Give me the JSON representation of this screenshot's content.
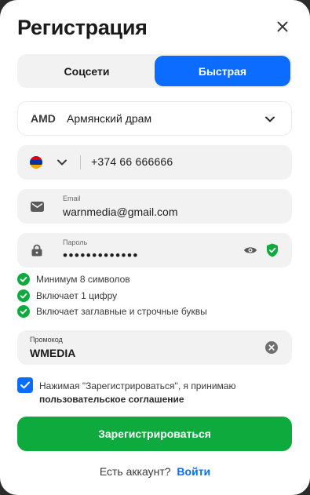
{
  "modal": {
    "title": "Регистрация"
  },
  "tabs": [
    {
      "label": "Соцсети",
      "active": false
    },
    {
      "label": "Быстрая",
      "active": true
    }
  ],
  "currency": {
    "code": "AMD",
    "name": "Армянский драм"
  },
  "phone": {
    "country_flag": "Armenia",
    "value": "+374 66 666666"
  },
  "email": {
    "label": "Email",
    "value": "warnmedia@gmail.com"
  },
  "password": {
    "label": "Пароль",
    "value": "•••••••••••••"
  },
  "password_rules": [
    "Минимум 8 символов",
    "Включает 1 цифру",
    "Включает заглавные и строчные буквы"
  ],
  "promo": {
    "label": "Промокод",
    "value": "WMEDIA"
  },
  "agreement": {
    "text": "Нажимая \"Зарегистрироваться\", я принимаю",
    "link": "пользовательское соглашение",
    "checked": true
  },
  "submit_label": "Зарегистрироваться",
  "footer": {
    "question": "Есть аккаунт?",
    "link": "Войти"
  },
  "colors": {
    "accent": "#0b6cff",
    "success": "#0eaa3d",
    "field_bg": "#f2f2f2"
  }
}
